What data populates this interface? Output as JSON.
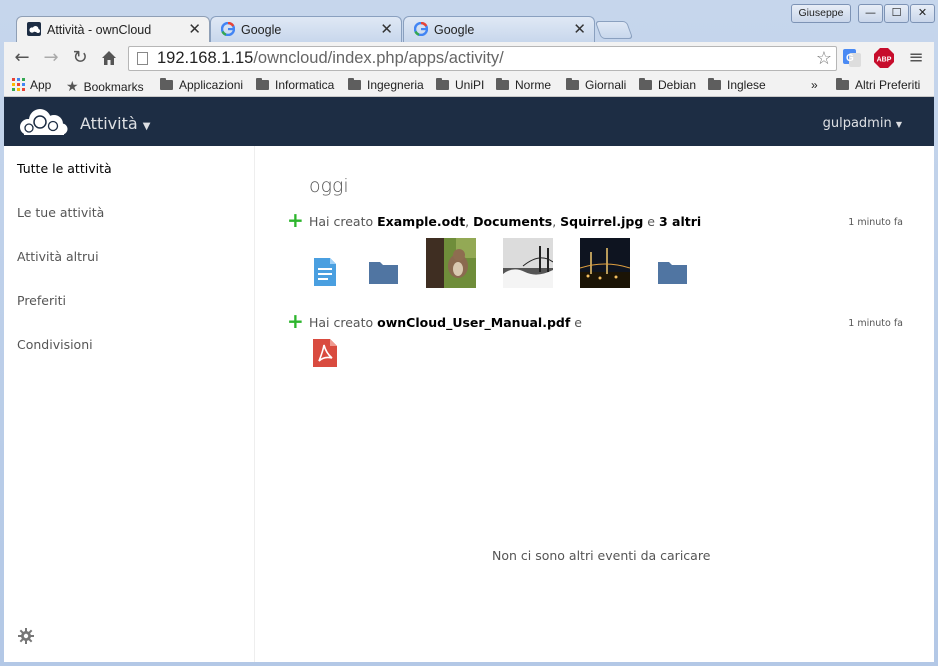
{
  "browser": {
    "profile_name": "Giuseppe",
    "tabs": [
      {
        "title": "Attività - ownCloud",
        "active": true
      },
      {
        "title": "Google",
        "active": false
      },
      {
        "title": "Google",
        "active": false
      }
    ],
    "url_host": "192.168.1.15",
    "url_path": "/owncloud/index.php/apps/activity/",
    "bookmarks": [
      "App",
      "Bookmarks",
      "Applicazioni",
      "Informatica",
      "Ingegneria",
      "UniPI",
      "Norme",
      "Giornali",
      "Debian",
      "Inglese"
    ],
    "more_bookmarks": "Altri Preferiti",
    "extension_abp": "ABP"
  },
  "owncloud": {
    "app_name": "Attività",
    "user": "gulpadmin",
    "nav": [
      "Tutte le attività",
      "Le tue attività",
      "Attività altrui",
      "Preferiti",
      "Condivisioni"
    ],
    "day_heading": "oggi",
    "activities": [
      {
        "prefix": "Hai creato",
        "file1": "Example.odt",
        "sep1": ", ",
        "file2": "Documents",
        "sep2": ", ",
        "file3": "Squirrel.jpg",
        "middle": " e ",
        "more": "3 altri",
        "time": "1 minuto fa"
      },
      {
        "prefix": "Hai creato",
        "file1": "ownCloud_User_Manual.pdf",
        "suffix": " e",
        "time": "1 minuto fa"
      }
    ],
    "empty_message": "Non ci sono altri eventi da caricare"
  },
  "colors": {
    "header": "#1d2d44",
    "accent_green": "#2db52d",
    "folder": "#5075a2",
    "doc": "#4a9fe0",
    "pdf": "#d94b3f"
  }
}
